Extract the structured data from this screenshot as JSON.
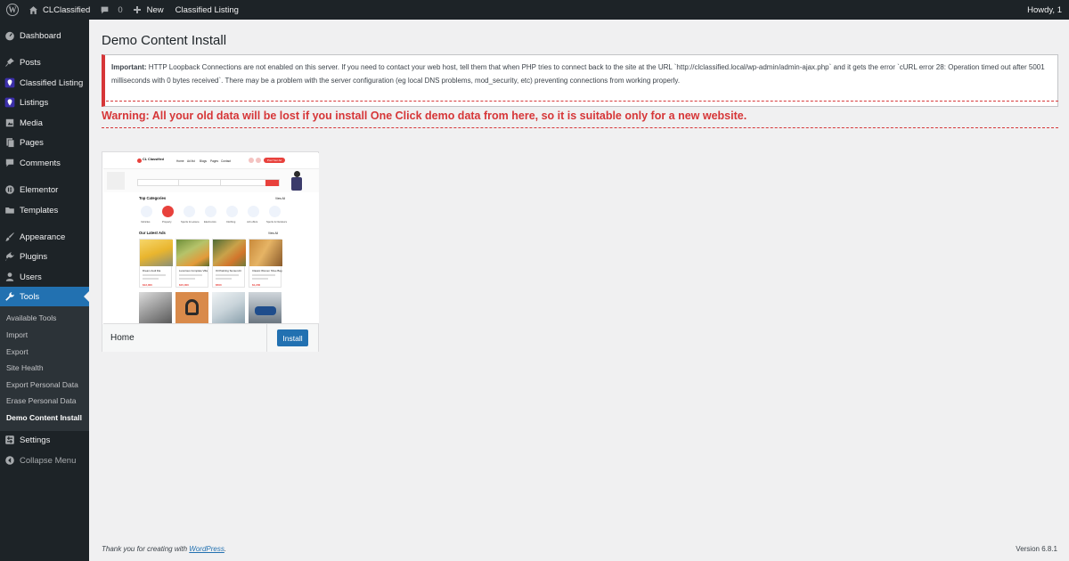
{
  "adminbar": {
    "site_name": "CLClassified",
    "comments_count": "0",
    "new_label": "New",
    "classified_label": "Classified Listing",
    "howdy": "Howdy, 1"
  },
  "sidebar": {
    "items": [
      {
        "label": "Dashboard",
        "icon": "dashboard-icon"
      },
      {
        "label": "Posts",
        "icon": "pin-icon"
      },
      {
        "label": "Classified Listing",
        "icon": "location-pin-icon"
      },
      {
        "label": "Listings",
        "icon": "location-pin-icon"
      },
      {
        "label": "Media",
        "icon": "media-icon"
      },
      {
        "label": "Pages",
        "icon": "pages-icon"
      },
      {
        "label": "Comments",
        "icon": "comment-icon"
      },
      {
        "label": "Elementor",
        "icon": "elementor-icon"
      },
      {
        "label": "Templates",
        "icon": "folder-icon"
      },
      {
        "label": "Appearance",
        "icon": "brush-icon"
      },
      {
        "label": "Plugins",
        "icon": "plug-icon"
      },
      {
        "label": "Users",
        "icon": "users-icon"
      },
      {
        "label": "Tools",
        "icon": "wrench-icon"
      }
    ],
    "submenu": [
      "Available Tools",
      "Import",
      "Export",
      "Site Health",
      "Export Personal Data",
      "Erase Personal Data",
      "Demo Content Install"
    ],
    "settings_label": "Settings",
    "collapse_label": "Collapse Menu"
  },
  "main": {
    "title": "Demo Content Install",
    "notice_strong": "Important:",
    "notice_text": "HTTP Loopback Connections are not enabled on this server. If you need to contact your web host, tell them that when PHP tries to connect back to the site at the URL `http://clclassified.local/wp-admin/admin-ajax.php` and it gets the error `cURL error 28: Operation timed out after 5001 milliseconds with 0 bytes received`. There may be a problem with the server configuration (eg local DNS problems, mod_security, etc) preventing connections from working properly.",
    "warning": "Warning: All your old data will be lost if you install One Click demo data from here, so it is suitable only for a new website.",
    "demo": {
      "name": "Home",
      "install_label": "Install",
      "preview": {
        "logo": "CL Classified",
        "nav": [
          "Home",
          "Ad list",
          "Blogs",
          "Pages",
          "Contact"
        ],
        "cta": "Post Your Ad",
        "top_categories": "Top Categories",
        "view_all": "View All",
        "categories": [
          "Vehicles",
          "Property",
          "Sports & Leisure",
          "Electronics",
          "Clothing",
          "Job offers",
          "Sports & Outdoors"
        ],
        "latest_ads": "Our Latest Ads",
        "ad_titles": [
          "Dream Audi Dia",
          "Luxurious Complete Villa",
          "Oil Painting Sunset Art",
          "Classic Women Shoe Bag"
        ],
        "ad_prices": [
          "$12,000",
          "$15,000",
          "$500",
          "$1,200"
        ]
      }
    }
  },
  "footer": {
    "thanks_prefix": "Thank you for creating with ",
    "thanks_link": "WordPress",
    "thanks_suffix": ".",
    "version": "Version 6.8.1"
  },
  "colors": {
    "adminbar_bg": "#1d2327",
    "accent": "#2271b1",
    "error": "#d63638",
    "background": "#f0f0f1"
  }
}
